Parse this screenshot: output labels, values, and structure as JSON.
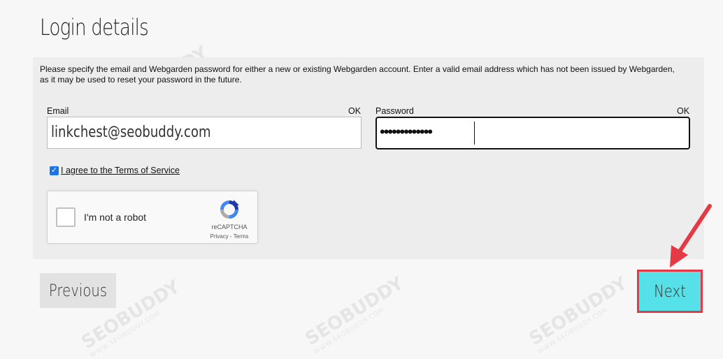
{
  "page": {
    "title": "Login details",
    "intro": "Please specify the email and Webgarden password for either a new or existing Webgarden account. Enter a valid email address which has not been issued by Webgarden, as it may be used to reset your password in the future."
  },
  "email": {
    "label": "Email",
    "status": "OK",
    "value": "linkchest@seobuddy.com"
  },
  "password": {
    "label": "Password",
    "status": "OK",
    "masked_value": "•••••••••••••"
  },
  "terms": {
    "checked": true,
    "label": "I agree to the Terms of Service"
  },
  "recaptcha": {
    "label": "I'm not a robot",
    "brand": "reCAPTCHA",
    "links": "Privacy - Terms",
    "icon": "recaptcha-logo"
  },
  "buttons": {
    "previous": "Previous",
    "next": "Next"
  },
  "annotation": {
    "highlight_color": "#e43a45",
    "arrow_color": "#e43a45"
  },
  "watermark": {
    "text": "SEOBUDDY",
    "subtext": "WWW.SEOBUDDY.COM"
  },
  "colors": {
    "next_button": "#56e0e8",
    "previous_button": "#e2e2e2",
    "panel": "#ededed"
  }
}
